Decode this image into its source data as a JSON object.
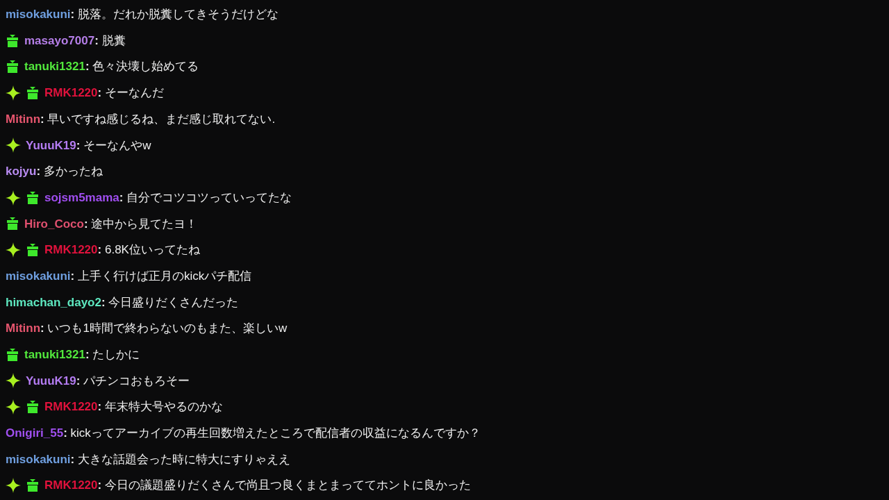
{
  "messages": [
    {
      "user": "misokakuni",
      "color": "#6f9fe0",
      "sparkle": false,
      "gift": false,
      "separator": ":",
      "text": "脱落。だれか脱糞してきそうだけどな"
    },
    {
      "user": "masayo7007",
      "color": "#b57ee8",
      "sparkle": false,
      "gift": true,
      "separator": ":",
      "text": "脱糞"
    },
    {
      "user": "tanuki1321",
      "color": "#52e83c",
      "sparkle": false,
      "gift": true,
      "separator": ":",
      "text": "色々決壊し始めてる"
    },
    {
      "user": "RMK1220",
      "color": "#e0123c",
      "sparkle": true,
      "gift": true,
      "separator": ":",
      "text": "そーなんだ"
    },
    {
      "user": "Mitinn",
      "color": "#e8566f",
      "sparkle": false,
      "gift": false,
      "separator": ":",
      "text": "早いですね感じるね、まだ感じ取れてない."
    },
    {
      "user": "YuuuK19",
      "color": "#b47cf2",
      "sparkle": true,
      "gift": false,
      "separator": ":",
      "text": "そーなんやw"
    },
    {
      "user": "kojyu",
      "color": "#b98cf2",
      "sparkle": false,
      "gift": false,
      "separator": ":",
      "text": "多かったね"
    },
    {
      "user": "sojsm5mama",
      "color": "#a04ef0",
      "sparkle": true,
      "gift": true,
      "separator": ":",
      "text": "自分でコツコツっていってたな"
    },
    {
      "user": "Hiro_Coco",
      "color": "#e0506f",
      "sparkle": false,
      "gift": true,
      "separator": ":",
      "text": "途中から見てたヨ！"
    },
    {
      "user": "RMK1220",
      "color": "#e0123c",
      "sparkle": true,
      "gift": true,
      "separator": ":",
      "text": "6.8K位いってたね"
    },
    {
      "user": "misokakuni",
      "color": "#6f9fe0",
      "sparkle": false,
      "gift": false,
      "separator": ":",
      "text": "上手く行けば正月のkickパチ配信"
    },
    {
      "user": "himachan_dayo2",
      "color": "#5ee8c0",
      "sparkle": false,
      "gift": false,
      "separator": ":",
      "text": "今日盛りだくさんだった"
    },
    {
      "user": "Mitinn",
      "color": "#e8566f",
      "sparkle": false,
      "gift": false,
      "separator": ":",
      "text": "いつも1時間で終わらないのもまた、楽しいw"
    },
    {
      "user": "tanuki1321",
      "color": "#52e83c",
      "sparkle": false,
      "gift": true,
      "separator": ":",
      "text": "たしかに"
    },
    {
      "user": "YuuuK19",
      "color": "#b47cf2",
      "sparkle": true,
      "gift": false,
      "separator": ":",
      "text": "パチンコおもろそー"
    },
    {
      "user": "RMK1220",
      "color": "#e0123c",
      "sparkle": true,
      "gift": true,
      "separator": ":",
      "text": "年末特大号やるのかな"
    },
    {
      "user": "Onigiri_55",
      "color": "#a050f0",
      "sparkle": false,
      "gift": false,
      "separator": ":",
      "text": "kickってアーカイブの再生回数増えたところで配信者の収益になるんですか？"
    },
    {
      "user": "misokakuni",
      "color": "#6f9fe0",
      "sparkle": false,
      "gift": false,
      "separator": ":",
      "text": "大きな話題会った時に特大にすりゃええ"
    },
    {
      "user": "RMK1220",
      "color": "#e0123c",
      "sparkle": true,
      "gift": true,
      "separator": ":",
      "text": "今日の議題盛りだくさんで尚且つ良くまとまっててホントに良かった"
    }
  ]
}
